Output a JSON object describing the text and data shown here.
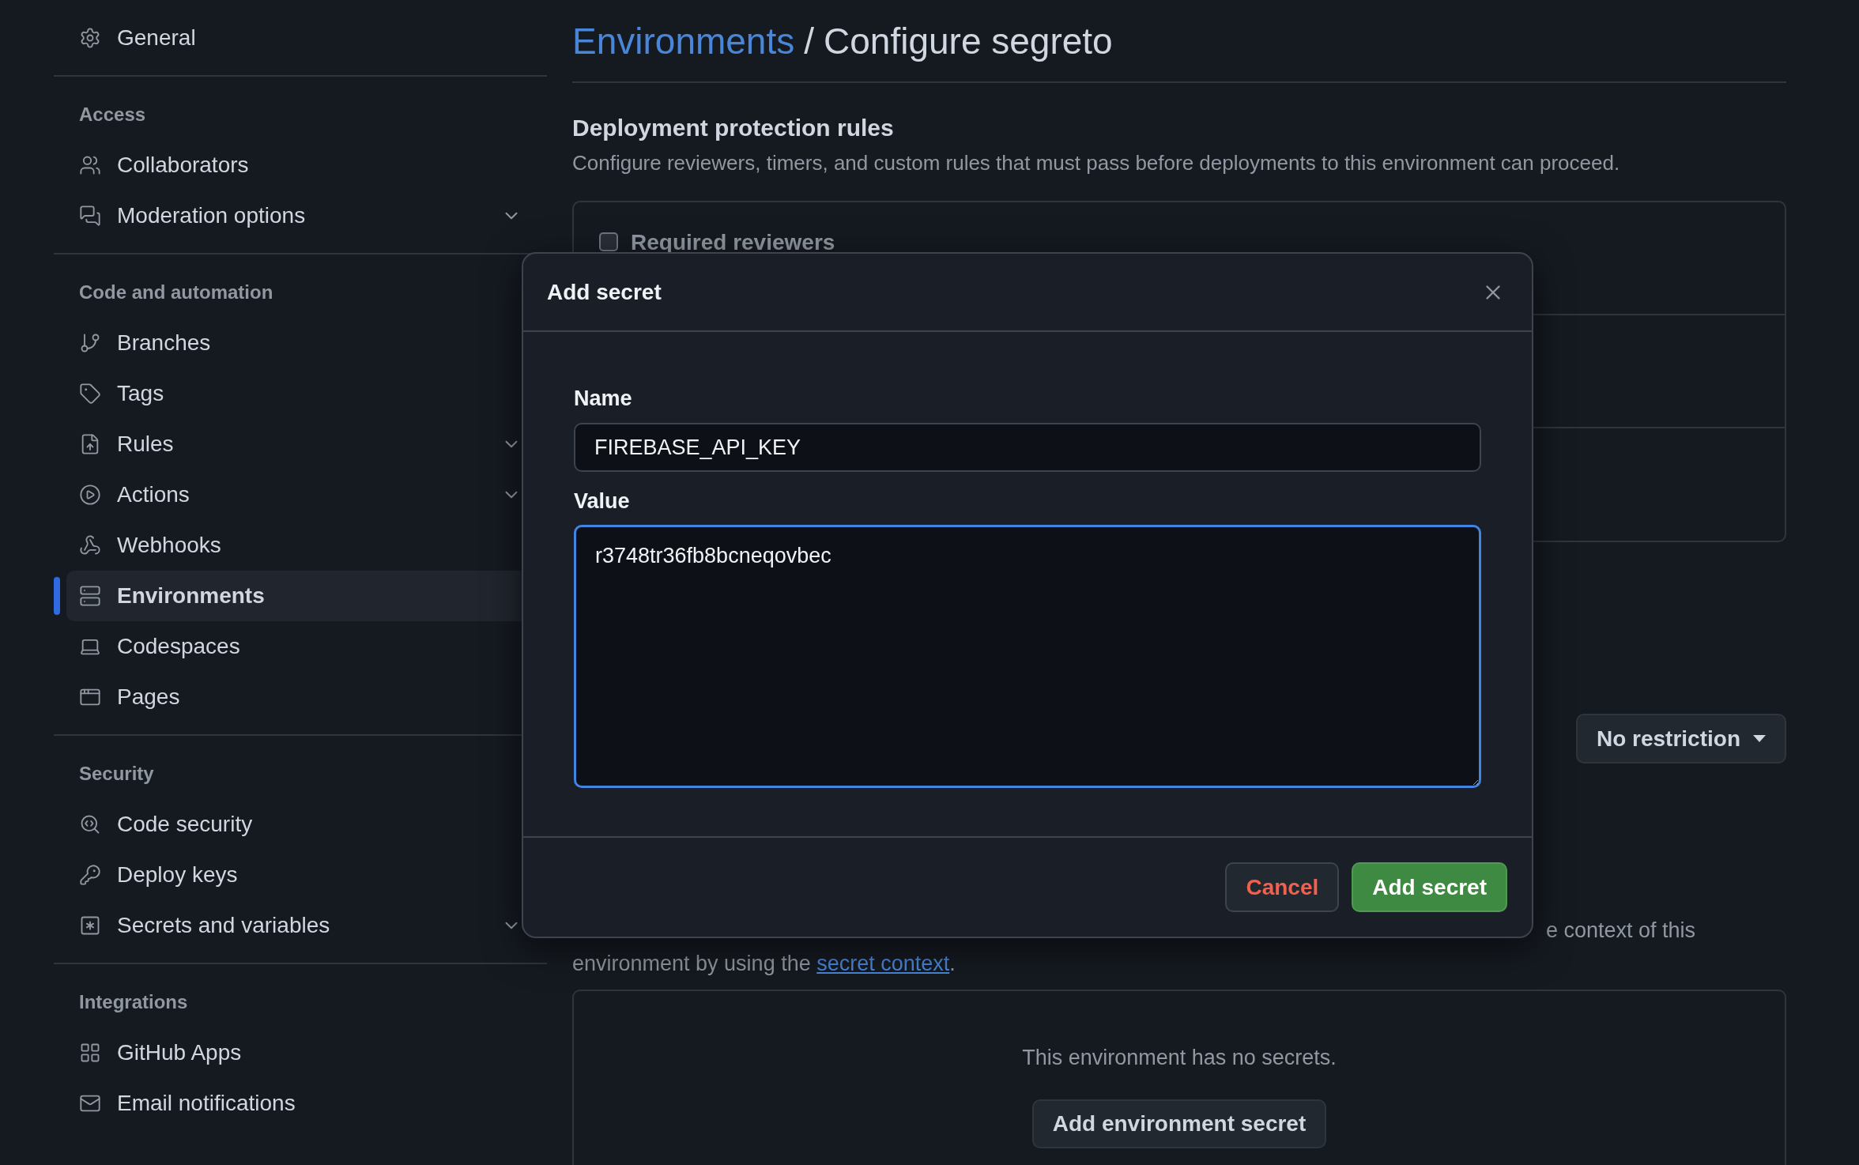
{
  "sidebar": {
    "groups": [
      {
        "items": [
          {
            "label": "General",
            "has_submenu": false,
            "selected": false
          }
        ]
      },
      {
        "heading": "Access",
        "items": [
          {
            "label": "Collaborators",
            "has_submenu": false,
            "selected": false
          },
          {
            "label": "Moderation options",
            "has_submenu": true,
            "selected": false
          }
        ]
      },
      {
        "heading": "Code and automation",
        "items": [
          {
            "label": "Branches",
            "has_submenu": false,
            "selected": false
          },
          {
            "label": "Tags",
            "has_submenu": false,
            "selected": false
          },
          {
            "label": "Rules",
            "has_submenu": true,
            "selected": false
          },
          {
            "label": "Actions",
            "has_submenu": true,
            "selected": false
          },
          {
            "label": "Webhooks",
            "has_submenu": false,
            "selected": false
          },
          {
            "label": "Environments",
            "has_submenu": false,
            "selected": true
          },
          {
            "label": "Codespaces",
            "has_submenu": false,
            "selected": false
          },
          {
            "label": "Pages",
            "has_submenu": false,
            "selected": false
          }
        ]
      },
      {
        "heading": "Security",
        "items": [
          {
            "label": "Code security",
            "has_submenu": false,
            "selected": false
          },
          {
            "label": "Deploy keys",
            "has_submenu": false,
            "selected": false
          },
          {
            "label": "Secrets and variables",
            "has_submenu": true,
            "selected": false
          }
        ]
      },
      {
        "heading": "Integrations",
        "items": [
          {
            "label": "GitHub Apps",
            "has_submenu": false,
            "selected": false
          },
          {
            "label": "Email notifications",
            "has_submenu": false,
            "selected": false
          }
        ]
      }
    ]
  },
  "header": {
    "breadcrumb_link": "Environments",
    "separator": "/",
    "title": "Configure segreto"
  },
  "protection": {
    "title": "Deployment protection rules",
    "description": "Configure reviewers, timers, and custom rules that must pass before deployments to this environment can proceed.",
    "rules": [
      {
        "label": "Required reviewers",
        "checked": false
      }
    ]
  },
  "branches": {
    "button": "No restriction"
  },
  "secrets": {
    "description_line_1": "e context of this",
    "description_line_2": "environment by using the ",
    "link": "secret context",
    "description_end": ".",
    "empty_text": "This environment has no secrets.",
    "button": "Add environment secret"
  },
  "modal": {
    "title": "Add secret",
    "fields": [
      {
        "kind": "input",
        "label": "Name",
        "value": "FIREBASE_API_KEY",
        "focused": false
      },
      {
        "kind": "textarea",
        "label": "Value",
        "value": "r3748tr36fb8bcneqovbec",
        "focused": true
      }
    ],
    "buttons": [
      {
        "kind": "danger",
        "label": "Cancel"
      },
      {
        "kind": "primary",
        "label": "Add secret"
      }
    ]
  }
}
